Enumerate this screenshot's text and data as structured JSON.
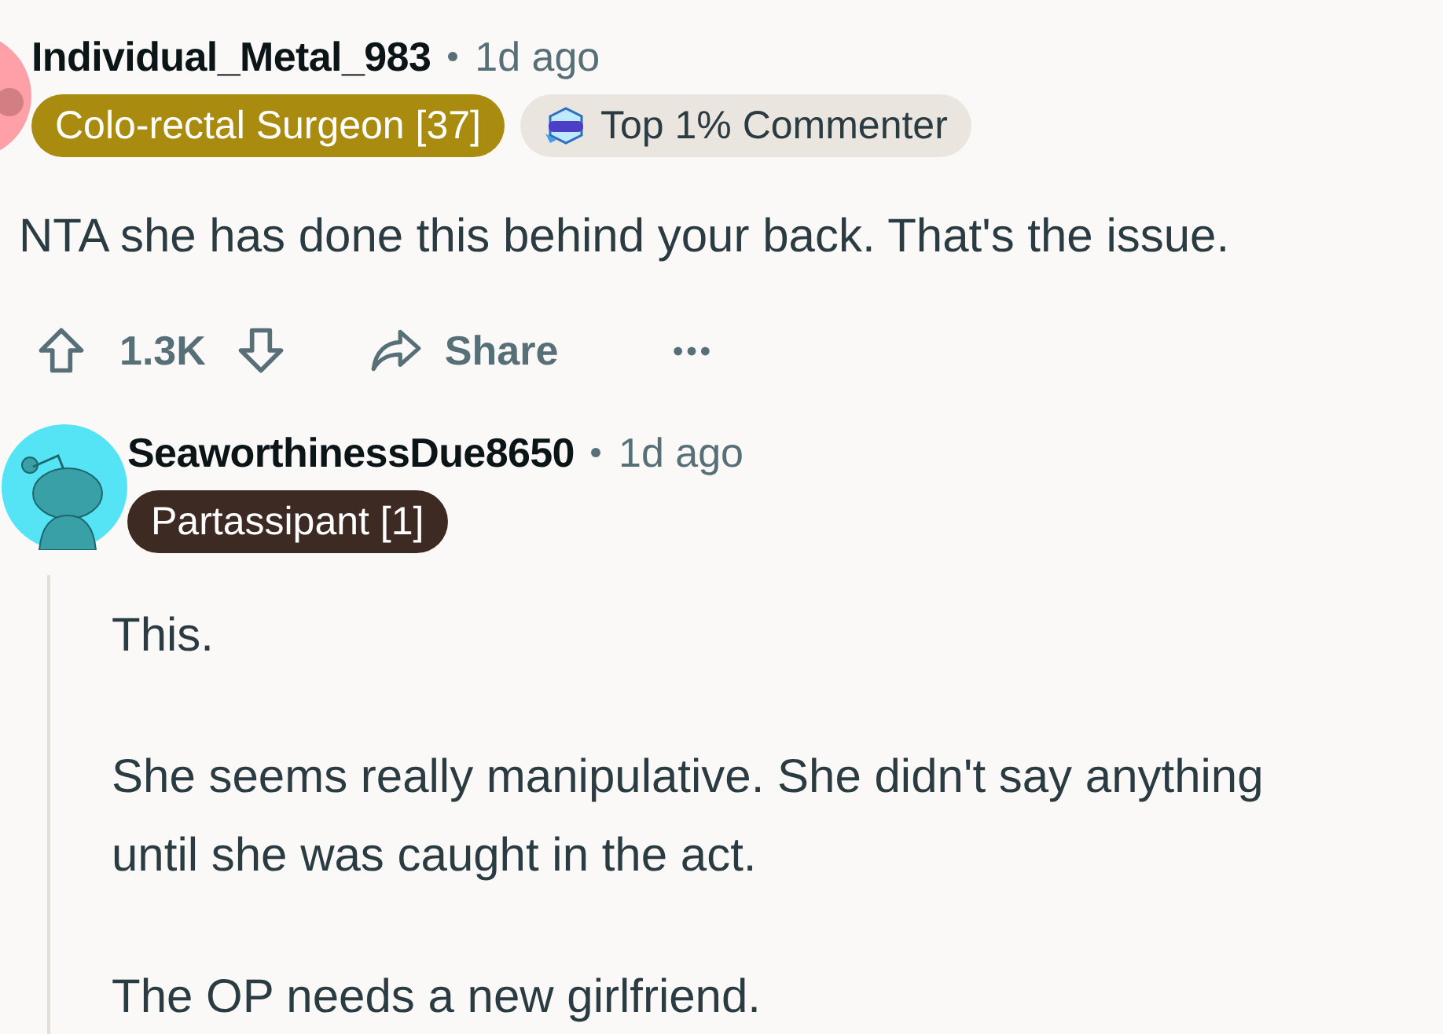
{
  "comments": [
    {
      "username": "Individual_Metal_983",
      "time": "1d ago",
      "avatar": {
        "color": "#ff9fa8"
      },
      "flairs": [
        {
          "kind": "user",
          "text": "Colo-rectal Surgeon [37]",
          "color": "#a98b0f"
        },
        {
          "kind": "achievement",
          "text": "Top 1% Commenter"
        }
      ],
      "body": [
        "NTA she has done this behind your back. That's the issue."
      ],
      "actions": {
        "score": "1.3K",
        "share": "Share"
      }
    },
    {
      "username": "SeaworthinessDue8650",
      "time": "1d ago",
      "avatar": {
        "color": "#54e4f5"
      },
      "flairs": [
        {
          "kind": "user",
          "text": "Partassipant [1]",
          "color": "#3d2a22"
        }
      ],
      "body": [
        "This.",
        "She seems really manipulative. She didn't say anything until she was caught in the act.",
        "The OP needs a new girlfriend."
      ]
    }
  ]
}
